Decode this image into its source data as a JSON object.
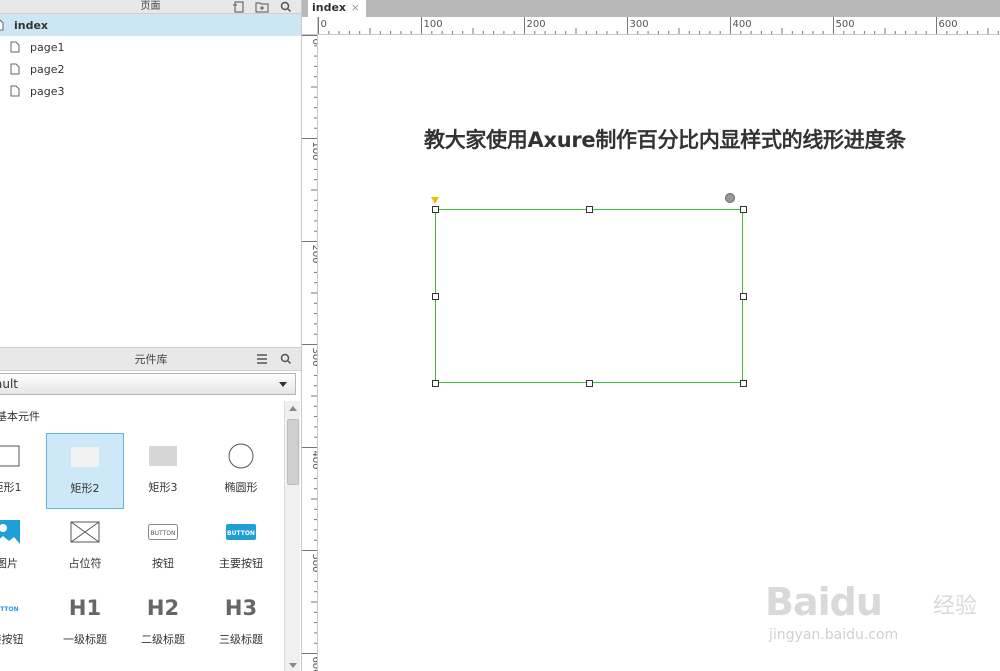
{
  "pages_panel": {
    "title": "页面",
    "items": [
      {
        "label": "index",
        "selected": true
      },
      {
        "label": "page1",
        "selected": false
      },
      {
        "label": "page2",
        "selected": false
      },
      {
        "label": "page3",
        "selected": false
      }
    ]
  },
  "library_panel": {
    "title": "元件库",
    "library_select": "ault",
    "category": "基本元件",
    "widgets": [
      {
        "label": "矩形1",
        "icon": "rect-outline-icon"
      },
      {
        "label": "矩形2",
        "icon": "rect-light-icon",
        "selected": true
      },
      {
        "label": "矩形3",
        "icon": "rect-gray-icon"
      },
      {
        "label": "椭圆形",
        "icon": "ellipse-icon"
      },
      {
        "label": "图片",
        "icon": "image-icon"
      },
      {
        "label": "占位符",
        "icon": "placeholder-icon"
      },
      {
        "label": "按钮",
        "icon": "button-icon",
        "icon_text": "BUTTON"
      },
      {
        "label": "主要按钮",
        "icon": "primary-button-icon",
        "icon_text": "BUTTON"
      },
      {
        "label": "接按钮",
        "icon": "link-button-icon",
        "icon_text": "UTTON"
      },
      {
        "label": "一级标题",
        "icon": "h1-icon",
        "icon_text": "H1"
      },
      {
        "label": "二级标题",
        "icon": "h2-icon",
        "icon_text": "H2"
      },
      {
        "label": "三级标题",
        "icon": "h3-icon",
        "icon_text": "H3"
      }
    ]
  },
  "tab": {
    "label": "index",
    "close": "×"
  },
  "ruler": {
    "h_labels": [
      "0",
      "100",
      "200",
      "300",
      "400",
      "500",
      "600"
    ],
    "v_labels": [
      "0",
      "100",
      "200",
      "300",
      "400",
      "500",
      "600"
    ]
  },
  "canvas": {
    "heading": "教大家使用Axure制作百分比内显样式的线形进度条"
  },
  "watermark": {
    "brand": "Baidu",
    "jingyan": "经验",
    "url": "jingyan.baidu.com"
  },
  "colors": {
    "selection_bg": "#cce6f4",
    "widget_selected_border": "#65b2e3",
    "rect_border": "#3dbe3d",
    "primary_button": "#1e9fd8"
  }
}
